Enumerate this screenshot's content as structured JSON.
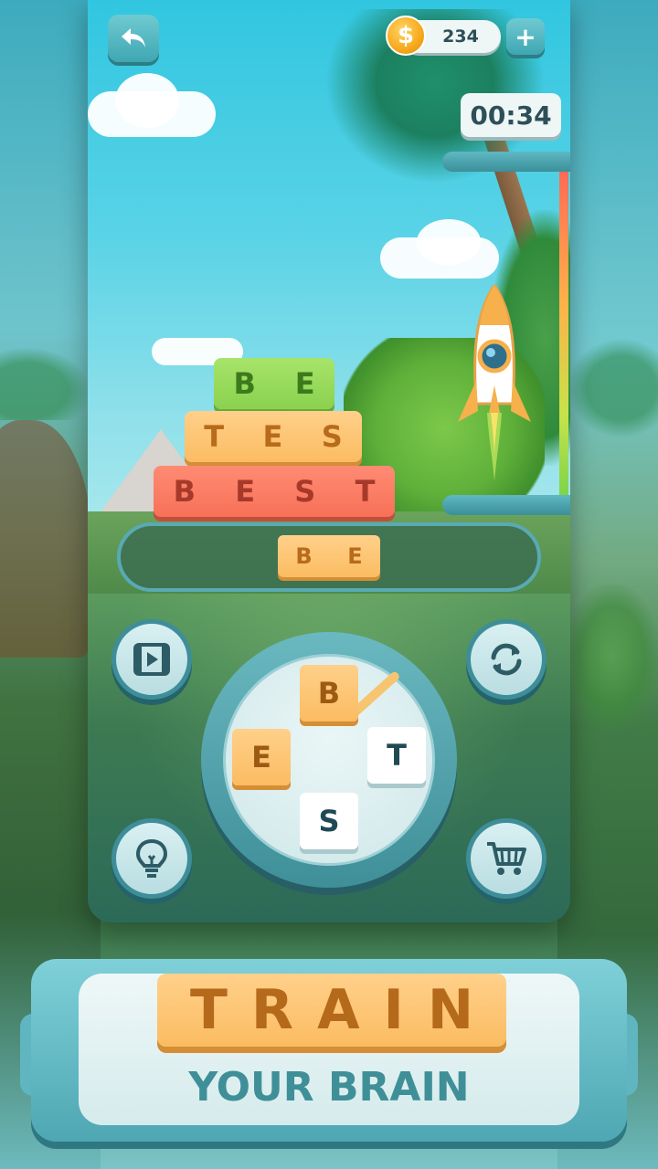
{
  "top_bar": {
    "back_icon": "back-arrow-icon",
    "coins": "234",
    "coin_icon_glyph": "$",
    "add_coins_glyph": "+"
  },
  "timer": "00:34",
  "progress": {
    "fraction": 0.45
  },
  "found_words": [
    {
      "letters": [
        "B",
        "E"
      ],
      "color": "green"
    },
    {
      "letters": [
        "T",
        "E",
        "S"
      ],
      "color": "orange"
    },
    {
      "letters": [
        "B",
        "E",
        "S",
        "T"
      ],
      "color": "red"
    }
  ],
  "current_answer": [
    "B",
    "E"
  ],
  "wheel_letters": [
    {
      "letter": "B",
      "selected": true
    },
    {
      "letter": "E",
      "selected": true
    },
    {
      "letter": "T",
      "selected": false
    },
    {
      "letter": "S",
      "selected": false
    }
  ],
  "buttons": {
    "video": "video-icon",
    "shuffle": "shuffle-icon",
    "hint": "lightbulb-icon",
    "shop": "cart-icon"
  },
  "banner": {
    "title": "TRAIN",
    "subtitle": "YOUR BRAIN"
  },
  "colors": {
    "accent": "#4ea7b3",
    "tile_orange": "#fbbc62",
    "tile_green": "#8bd14e",
    "tile_red": "#f77158"
  }
}
